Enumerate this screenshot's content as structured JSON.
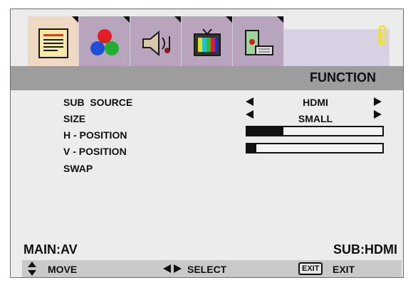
{
  "header": {
    "title": "FUNCTION"
  },
  "tabs": [
    {
      "name": "picture",
      "icon": "document-icon",
      "active": true
    },
    {
      "name": "color",
      "icon": "color-balls-icon",
      "active": false
    },
    {
      "name": "audio",
      "icon": "speaker-icon",
      "active": false
    },
    {
      "name": "tv",
      "icon": "tv-icon",
      "active": false
    },
    {
      "name": "setup",
      "icon": "computer-icon",
      "active": false
    }
  ],
  "menu": {
    "sub_source": {
      "label": "SUB  SOURCE",
      "value": "HDMI"
    },
    "size": {
      "label": "SIZE",
      "value": "SMALL"
    },
    "h_position": {
      "label": "H - POSITION",
      "level": 0.27
    },
    "v_position": {
      "label": "V - POSITION",
      "level": 0.07
    },
    "swap": {
      "label": "SWAP"
    }
  },
  "status": {
    "main": "MAIN:AV",
    "sub": "SUB:HDMI"
  },
  "footer": {
    "move": "MOVE",
    "select": "SELECT",
    "exit_key": "EXIT",
    "exit": "EXIT"
  }
}
